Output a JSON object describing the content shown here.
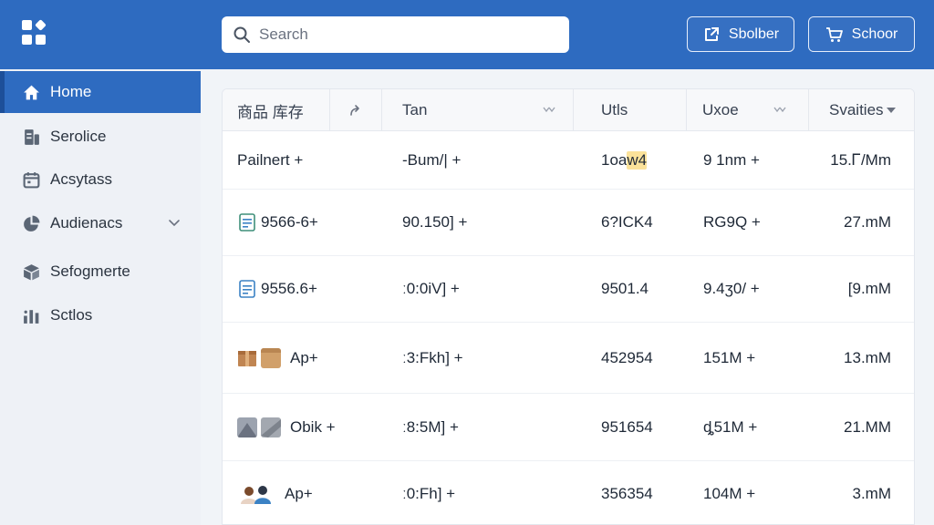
{
  "search": {
    "placeholder": "Search"
  },
  "header": {
    "buttons": [
      {
        "label": "Sbolber",
        "icon": "export-icon"
      },
      {
        "label": "Schoor",
        "icon": "cart-icon"
      }
    ]
  },
  "sidebar": {
    "items": [
      {
        "label": "Home",
        "icon": "home-icon",
        "active": true
      },
      {
        "label": "Serolice",
        "icon": "document-icon"
      },
      {
        "label": "Acsytass",
        "icon": "calendar-icon"
      },
      {
        "label": "Audienacs",
        "icon": "pie-chart-icon",
        "expandable": true
      },
      {
        "label": "Sefogmerte",
        "icon": "box-icon"
      },
      {
        "label": "Sctlos",
        "icon": "bar-chart-icon"
      }
    ]
  },
  "table": {
    "columns": [
      "商品  库存",
      "",
      "Tan",
      "Utls",
      "Uxoe",
      "Svaities"
    ],
    "rows": [
      {
        "thumb": "",
        "product": "Pailnert +",
        "tan": "-Bum/| +",
        "utls_a": "1oa",
        "utls_b": "w4",
        "uxoe": "9 1nm +",
        "svaities": "15.Ꮁ/Mm"
      },
      {
        "thumb": "doc-thumb",
        "product": "9566-6+",
        "tan": "90.150] +",
        "utls_a": "6?ICK4",
        "utls_b": "",
        "uxoe": "RG9Q +",
        "svaities": "27.mM"
      },
      {
        "thumb": "doc-thumb",
        "product": "9556.6+",
        "tan": "ː0:0iV] +",
        "utls_a": "9501.4",
        "utls_b": "",
        "uxoe": "9.4ʒ0/ +",
        "svaities": "[9.mM"
      },
      {
        "thumb": "box-thumb",
        "product": "Ap+",
        "tan": "ː3:Fkh] +",
        "utls_a": "452954",
        "utls_b": "",
        "uxoe": "151M +",
        "svaities": "13.mM"
      },
      {
        "thumb": "gray-thumb",
        "product": "Obik +",
        "tan": "ː8:5M] +",
        "utls_a": "951654",
        "utls_b": "",
        "uxoe": "ȡ51M +",
        "svaities": "21.MM"
      },
      {
        "thumb": "people-thumb",
        "product": "Ap+",
        "tan": "ː0:Fh] +",
        "utls_a": "356354",
        "utls_b": "",
        "uxoe": "104M +",
        "svaities": "3.mM"
      }
    ]
  },
  "colors": {
    "brand": "#2e6bc0",
    "highlight": "#fbe29a"
  }
}
